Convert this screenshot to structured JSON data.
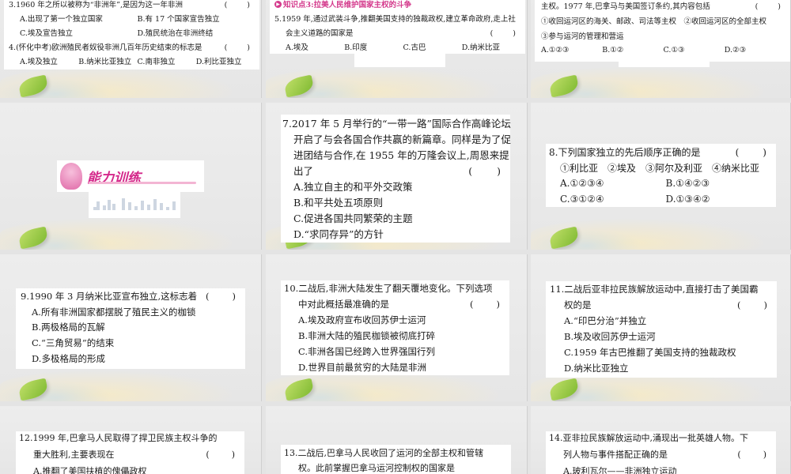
{
  "colors": {
    "accent_pink": "#d43a8c",
    "leaf_green": "#8cc63f"
  },
  "slides": [
    {
      "lines": [
        [
          "3.1960 年之所以被称为“非洲年”,是因为这一年非洲",
          "(　　)"
        ],
        [
          "A.出现了第一个独立国家",
          "B.有 17 个国家宣告独立"
        ],
        [
          "C.埃及宣告独立",
          "D.殖民统治在非洲终结"
        ],
        [
          "4.(怀化中考)欧洲殖民者奴役非洲几百年历史结束的标志是",
          "(　　)"
        ],
        [
          "A.埃及独立",
          "B.纳米比亚独立",
          "C.南非独立",
          "D.利比亚独立"
        ]
      ]
    },
    {
      "header": "知识点3:拉美人民维护国家主权的斗争",
      "lines": [
        [
          "5.1959 年,通过武装斗争,推翻美国支持的独裁政权,建立革命政府,走上社"
        ],
        [
          "会主义道路的国家是",
          "(　　)"
        ],
        [
          "A.埃及",
          "B.印度",
          "C.古巴",
          "D.纳米比亚"
        ]
      ]
    },
    {
      "lines": [
        [
          "主权。1977 年,巴拿马与美国签订条约,其内容包括",
          "(　　)"
        ],
        [
          "①收回运河区的海关、邮政、司法等主权　②收回运河区的全部主权"
        ],
        [
          "③参与运河的管理和营运"
        ],
        [
          "A.①②③",
          "B.①②",
          "C.①③",
          "D.②③"
        ]
      ]
    },
    {
      "banner_title": "能力训练",
      "lines": []
    },
    {
      "lines": [
        [
          "7.2017 年 5 月举行的“一带一路”国际合作高峰论坛"
        ],
        [
          "开启了与会各国合作共赢的新篇章。同样是为了促"
        ],
        [
          "进团结与合作,在 1955 年的万隆会议上,周恩来提"
        ],
        [
          "出了",
          "(　　)"
        ],
        [
          "A.独立自主的和平外交政策"
        ],
        [
          "B.和平共处五项原则"
        ],
        [
          "C.促进各国共同繁荣的主题"
        ],
        [
          "D.“求同存异”的方针"
        ]
      ]
    },
    {
      "lines": [
        [
          "8.下列国家独立的先后顺序正确的是",
          "(　　)"
        ],
        [
          "①利比亚　②埃及　③阿尔及利亚　④纳米比亚"
        ],
        [
          "A.①②③④",
          "B.①④②③"
        ],
        [
          "C.③①②④",
          "D.①③④②"
        ]
      ]
    },
    {
      "lines": [
        [
          "9.1990 年 3 月纳米比亚宣布独立,这标志着",
          "(　　)"
        ],
        [
          "A.所有非洲国家都摆脱了殖民主义的枷锁"
        ],
        [
          "B.两极格局的瓦解"
        ],
        [
          "C.“三角贸易”的结束"
        ],
        [
          "D.多极格局的形成"
        ]
      ]
    },
    {
      "lines": [
        [
          "10.二战后,非洲大陆发生了翻天覆地变化。下列选项"
        ],
        [
          "中对此概括最准确的是",
          "(　　)"
        ],
        [
          "A.埃及政府宣布收回苏伊士运河"
        ],
        [
          "B.非洲大陆的殖民枷锁被彻底打碎"
        ],
        [
          "C.非洲各国已经跨入世界强国行列"
        ],
        [
          "D.世界目前最贫穷的大陆是非洲"
        ]
      ]
    },
    {
      "lines": [
        [
          "11.二战后亚非拉民族解放运动中,直接打击了美国霸"
        ],
        [
          "权的是",
          "(　　)"
        ],
        [
          "A.“印巴分治”并独立"
        ],
        [
          "B.埃及收回苏伊士运河"
        ],
        [
          "C.1959 年古巴推翻了美国支持的独裁政权"
        ],
        [
          "D.纳米比亚独立"
        ]
      ]
    },
    {
      "lines": [
        [
          "12.1999 年,巴拿马人民取得了捍卫民族主权斗争的"
        ],
        [
          "重大胜利,主要表现在",
          "(　　)"
        ],
        [
          "A.推翻了美国扶植的傀儡政权"
        ]
      ]
    },
    {
      "lines": [
        [
          "13.二战后,巴拿马人民收回了运河的全部主权和管辖"
        ],
        [
          "权。此前掌握巴拿马运河控制权的国家是"
        ]
      ]
    },
    {
      "lines": [
        [
          "14.亚非拉民族解放运动中,涌现出一批英雄人物。下"
        ],
        [
          "列人物与事件搭配正确的是",
          "(　　)"
        ],
        [
          "A.玻利瓦尔——非洲独立运动"
        ]
      ]
    }
  ]
}
